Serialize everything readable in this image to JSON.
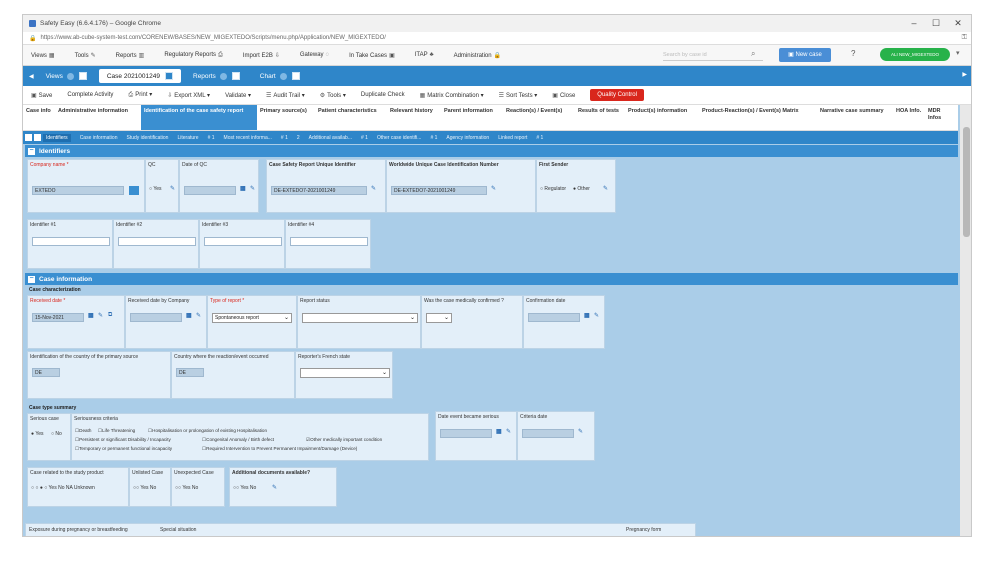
{
  "window": {
    "title": "Safety Easy (6.6.4.176) – Google Chrome",
    "url": "https://www.ab-cube-system-test.com/CORENEW/BASES/NEW_MIGEXTEDO/Scripts/menu.php/Application/NEW_MIGEXTEDO/",
    "controls": {
      "min": "–",
      "max": "☐",
      "close": "✕"
    }
  },
  "appbar": {
    "items": [
      "Views",
      "Tools",
      "Reports",
      "Regulatory Reports",
      "Import E2B",
      "Gateway",
      "In Take Cases",
      "ITAP",
      "Administration"
    ],
    "search_placeholder": "Search by case id",
    "new_case": "New case",
    "user": "ALI NEW_MIGEXTEDO"
  },
  "tabs": {
    "views": "Views",
    "case": "Case 2021001249",
    "reports": "Reports",
    "chart": "Chart"
  },
  "toolbar": {
    "save": "Save",
    "complete": "Complete Activity",
    "print": "Print",
    "export": "Export XML",
    "validate": "Validate",
    "audit": "Audit Trail",
    "tools": "Tools",
    "duplicate": "Duplicate Check",
    "matrix": "Matrix Combination",
    "sort": "Sort Tests",
    "close": "Close",
    "qc": "Quality Control"
  },
  "sectabs": [
    "Case info",
    "Administrative information",
    "Identification of the case safety report",
    "Primary source(s)",
    "Patient characteristics",
    "Relevant history",
    "Parent information",
    "Reaction(s) / Event(s)",
    "Results of tests",
    "Product(s) information",
    "Product-Reaction(s) / Event(s) Matrix",
    "Narrative case summary",
    "HOA Info.",
    "MDR Infos"
  ],
  "subtabs": [
    "Identifiers",
    "Case information",
    "Study identification",
    "Literature",
    "# 1",
    "Most recent informa...",
    "# 1",
    "2",
    "Additional availab...",
    "# 1",
    "Other case identifi...",
    "# 1",
    "Agency information",
    "Linked report",
    "# 1"
  ],
  "identifiers": {
    "title": "Identifiers",
    "company_label": "Company name *",
    "company_value": "EXTEDO",
    "qc_label": "QC",
    "qc_yes": "Yes",
    "date_qc_label": "Date of QC",
    "csr_label": "Case Safety Report Unique Identifier",
    "csr_value": "DE-EXTEDO7-2021001249",
    "wwid_label": "Worldwide Unique Case Identification Number",
    "wwid_value": "DE-EXTEDO7-2021001249",
    "sender_label": "First Sender",
    "sender_regulator": "Regulator",
    "sender_other": "Other",
    "id1": "Identifier #1",
    "id2": "Identifier #2",
    "id3": "Identifier #3",
    "id4": "Identifier #4"
  },
  "caseinfo": {
    "title": "Case information",
    "characterization": "Case characterization",
    "received_label": "Received date *",
    "received_value": "15-Nov-2021",
    "received_company": "Received date by Company",
    "type_label": "Type of report *",
    "type_value": "Spontaneous report",
    "status_label": "Report status",
    "confirmed_label": "Was the case medically confirmed ?",
    "confirm_date": "Confirmation date",
    "country_primary": "Identification of the country of the primary source",
    "country_primary_value": "DE",
    "country_reaction": "Country where the reaction/event occurred",
    "country_reaction_value": "DE",
    "french_state": "Reporter's French state"
  },
  "casetype": {
    "title": "Case type summary",
    "serious_label": "Serious case",
    "serious_yes": "Yes",
    "serious_no": "No",
    "criteria_label": "Seriousness criteria",
    "c1": "Death",
    "c2": "Life Threatening",
    "c3": "Hospitalisation or prolongation of existing Hospitalisation",
    "c4": "Persistent or significant Disability / Incapacity",
    "c5": "Congenital Anomaly / Birth defect",
    "c6": "Other medically important condition",
    "c7": "Temporary or permanent functional incapacity",
    "c8": "Required Intervention to Prevent Permanent Impairment/Damage (Device)",
    "serious_date": "Date event became serious",
    "criteria_date": "Criteria date",
    "study_related": "Case related to the study product",
    "study_opts": "Yes No NA Unknown",
    "unlisted": "Unlisted Case",
    "unlisted_opts": "Yes No",
    "unexpected": "Unexpected Case",
    "unexpected_opts": "Yes No",
    "additional": "Additional documents available?",
    "additional_opts": "Yes No"
  },
  "bottom": {
    "exposure": "Exposure during pregnancy or breastfeeding",
    "special": "Special situation",
    "pregnancy": "Pregnancy form"
  }
}
